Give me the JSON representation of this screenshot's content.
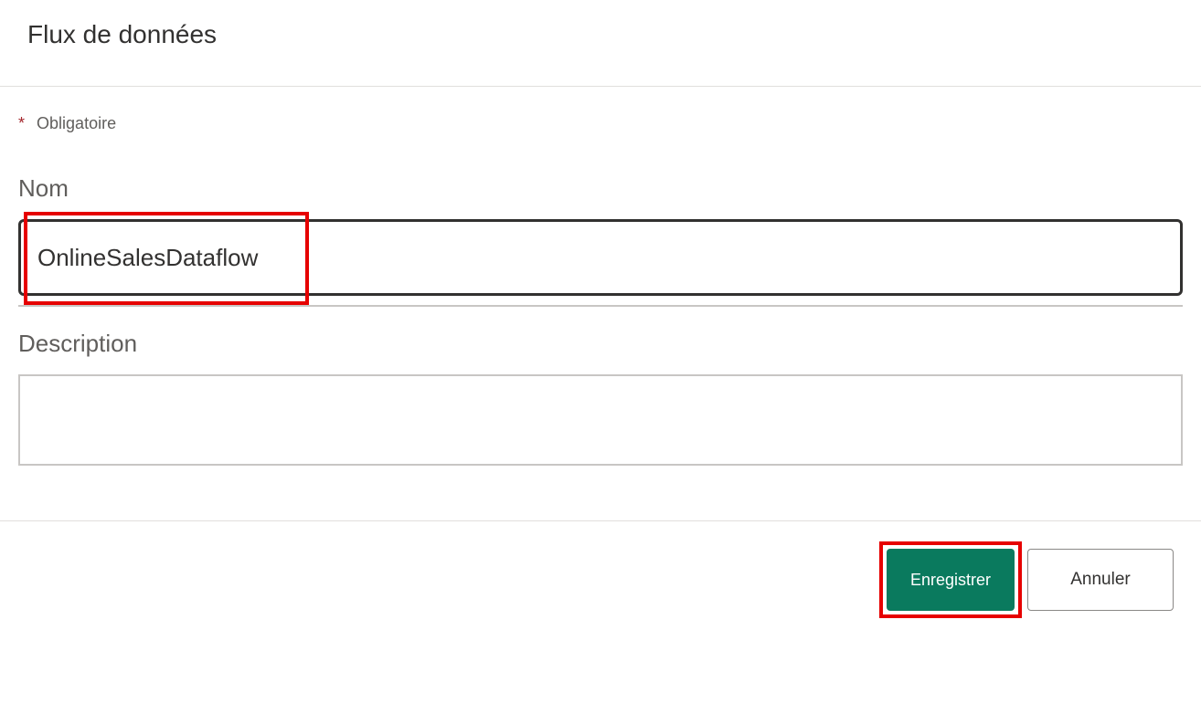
{
  "header": {
    "title": "Flux de données"
  },
  "form": {
    "required_label": "Obligatoire",
    "asterisk": "*",
    "name": {
      "label": "Nom",
      "value": "OnlineSalesDataflow"
    },
    "description": {
      "label": "Description",
      "value": ""
    }
  },
  "buttons": {
    "save": "Enregistrer",
    "cancel": "Annuler"
  }
}
